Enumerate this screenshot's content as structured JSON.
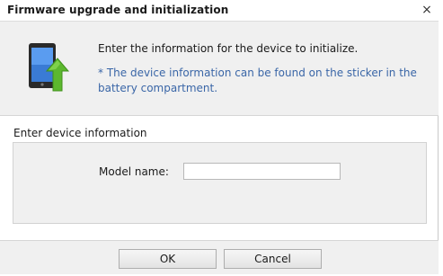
{
  "window": {
    "title": "Firmware upgrade and initialization",
    "close_glyph": "×"
  },
  "header": {
    "icon": "phone-upgrade-icon",
    "instruction": "Enter the information for the device to initialize.",
    "note": "* The device information can be found on the sticker in the battery compartment."
  },
  "device_info": {
    "section_label": "Enter device information",
    "model_label": "Model name:",
    "model_value": ""
  },
  "buttons": {
    "ok": "OK",
    "cancel": "Cancel"
  },
  "colors": {
    "note_text": "#3a66a7",
    "arrow_green": "#5cb82e",
    "panel_bg": "#f0f0f0"
  }
}
